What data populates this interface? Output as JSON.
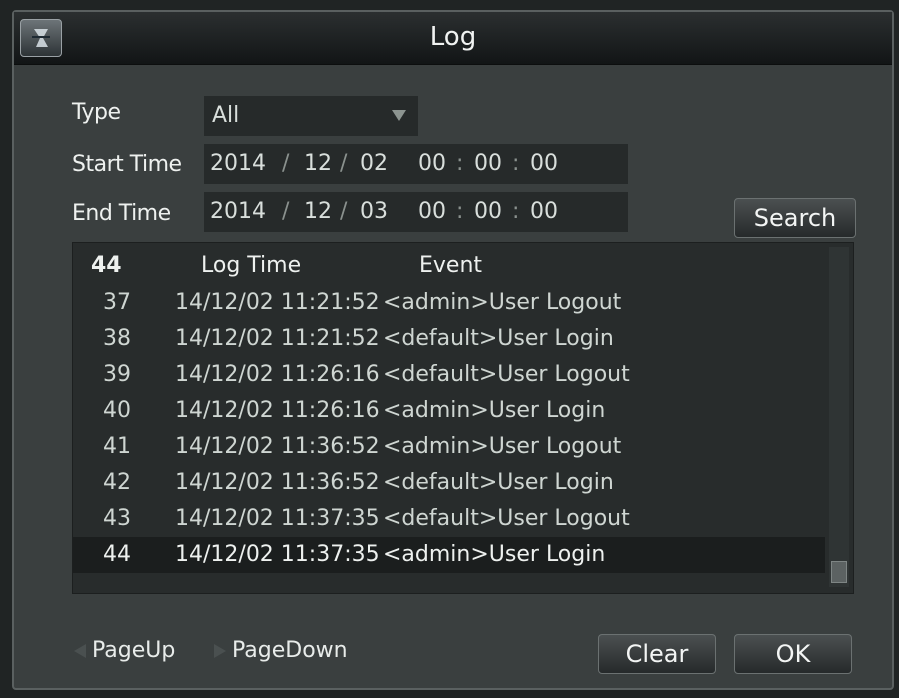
{
  "window": {
    "title": "Log"
  },
  "filters": {
    "type_label": "All",
    "type_caption": "Type",
    "start_caption": "Start Time",
    "end_caption": "End Time",
    "start": {
      "year": "2014",
      "month": "12",
      "day": "02",
      "hour": "00",
      "minute": "00",
      "second": "00"
    },
    "end": {
      "year": "2014",
      "month": "12",
      "day": "03",
      "hour": "00",
      "minute": "00",
      "second": "00"
    },
    "date_sep": "/",
    "time_sep": ":",
    "search_label": "Search"
  },
  "log_table": {
    "total": "44",
    "headers": {
      "time": "Log Time",
      "event": "Event"
    },
    "rows": [
      {
        "no": "37",
        "time": "14/12/02 11:21:52",
        "event": "<admin>User Logout"
      },
      {
        "no": "38",
        "time": "14/12/02 11:21:52",
        "event": "<default>User Login"
      },
      {
        "no": "39",
        "time": "14/12/02 11:26:16",
        "event": "<default>User Logout"
      },
      {
        "no": "40",
        "time": "14/12/02 11:26:16",
        "event": "<admin>User Login"
      },
      {
        "no": "41",
        "time": "14/12/02 11:36:52",
        "event": "<admin>User Logout"
      },
      {
        "no": "42",
        "time": "14/12/02 11:36:52",
        "event": "<default>User Login"
      },
      {
        "no": "43",
        "time": "14/12/02 11:37:35",
        "event": "<default>User Logout"
      },
      {
        "no": "44",
        "time": "14/12/02 11:37:35",
        "event": "<admin>User Login"
      }
    ],
    "selected_row": "44"
  },
  "footer": {
    "page_up": "PageUp",
    "page_down": "PageDown",
    "clear_label": "Clear",
    "ok_label": "OK"
  }
}
